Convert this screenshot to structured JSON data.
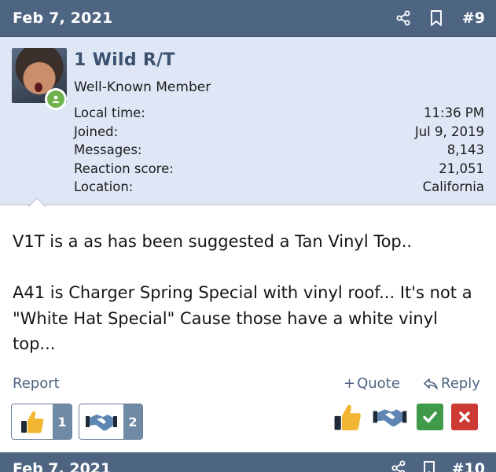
{
  "post": {
    "date": "Feb 7, 2021",
    "number": "#9",
    "author": {
      "name": "1 Wild R/T",
      "title": "Well-Known Member",
      "online": true
    },
    "stats": [
      {
        "label": "Local time:",
        "value": "11:36 PM"
      },
      {
        "label": "Joined:",
        "value": "Jul 9, 2019"
      },
      {
        "label": "Messages:",
        "value": "8,143"
      },
      {
        "label": "Reaction score:",
        "value": "21,051"
      },
      {
        "label": "Location:",
        "value": "California"
      }
    ],
    "body": [
      "V1T is a as has been suggested a Tan Vinyl Top..",
      "A41 is Charger Spring Special with vinyl roof... It's not a \"White Hat Special\" Cause those have a white vinyl top..."
    ],
    "actions": {
      "report": "Report",
      "quote": "Quote",
      "reply": "Reply"
    },
    "reactions": [
      {
        "icon": "thumbs-up-icon",
        "count": "1"
      },
      {
        "icon": "handshake-icon",
        "count": "2"
      }
    ],
    "reaction_picker": [
      "thumbs-up-icon",
      "handshake-icon",
      "check-icon",
      "x-icon"
    ]
  },
  "next_post": {
    "date": "Feb 7, 2021",
    "number": "#10"
  },
  "colors": {
    "header_bg": "#4e6582",
    "user_block_bg": "#dfe7f6",
    "username": "#3b5370",
    "link": "#4e6582",
    "online": "#6db24a",
    "agree": "#3f9a4a",
    "disagree": "#cc3a33",
    "thumb": "#f2b632"
  }
}
